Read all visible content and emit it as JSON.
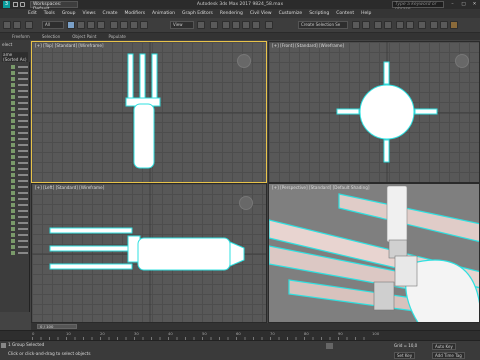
{
  "window": {
    "workspace_label": "Workspaces: Default",
    "title": "Autodesk 3ds Max 2017     9824_58.max",
    "search_placeholder": "Type a keyword or phrase"
  },
  "menu": [
    "Edit",
    "Tools",
    "Group",
    "Views",
    "Create",
    "Modifiers",
    "Animation",
    "Graph Editors",
    "Rendering",
    "Civil View",
    "Customize",
    "Scripting",
    "Content",
    "Help"
  ],
  "toolbar": {
    "filter": "All",
    "view": "View",
    "selection_set": "Create Selection Se"
  },
  "ribbon": [
    "Freeform",
    "Selection",
    "Object Paint",
    "Populate"
  ],
  "left_panel": {
    "title": "elect",
    "sort_label": "ame (Sorted As)"
  },
  "viewports": {
    "top": "[+] [Top] [Standard] [Wireframe]",
    "front": "[+] [Front] [Standard] [Wireframe]",
    "left": "[+] [Left] [Standard] [Wireframe]",
    "perspective": "[+] [Perspective] [Standard] [Default Shading]"
  },
  "navigation": {
    "frame_counter": "0 / 100"
  },
  "timeline": {
    "ticks": [
      "0",
      "10",
      "20",
      "30",
      "40",
      "50",
      "60",
      "70",
      "80",
      "90",
      "100"
    ]
  },
  "status": {
    "line1": "1 Group Selected",
    "line2": "Click or click-and-drag to select objects",
    "grid": "Grid = 10,0",
    "add_time_tag": "Add Time Tag",
    "auto_key": "Auto Key",
    "set_key": "Set Key",
    "key_filters": "Key Filters...",
    "selected": "Selected"
  },
  "colors": {
    "active_viewport_border": "#e8c34a",
    "wire_cyan": "#2fe0e0",
    "mesh_white": "#ffffff",
    "grid_bg": "#585858"
  }
}
